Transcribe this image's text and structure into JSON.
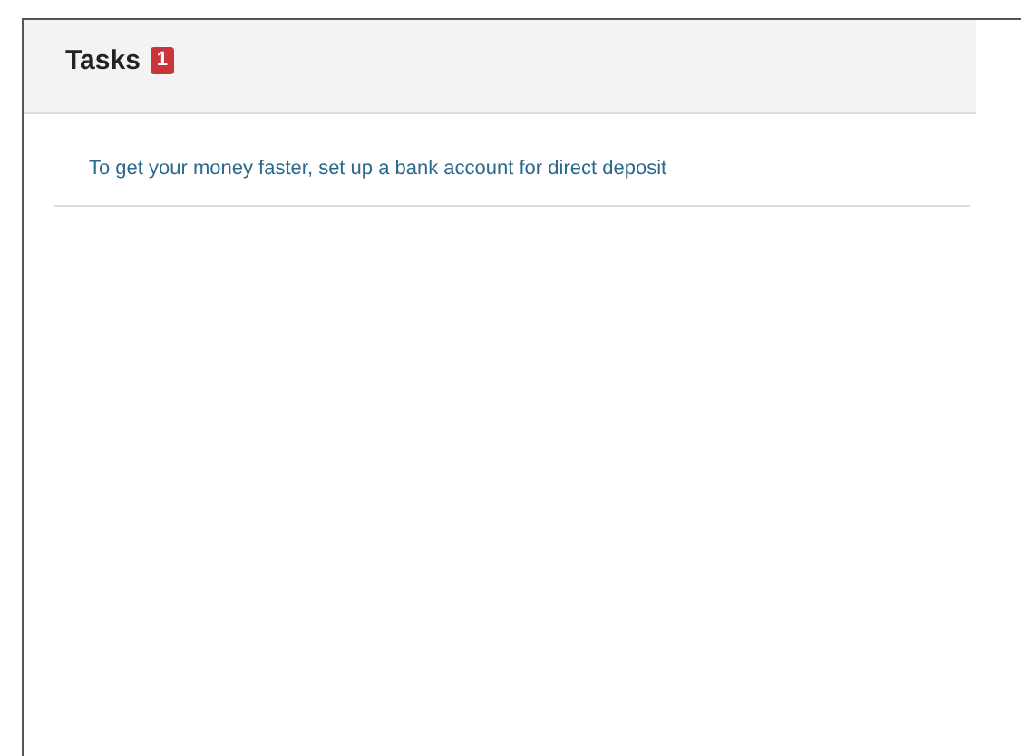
{
  "panel": {
    "title": "Tasks",
    "badge": "1"
  },
  "tasks": [
    {
      "text": "To get your money faster, set up a bank account for direct deposit"
    }
  ]
}
